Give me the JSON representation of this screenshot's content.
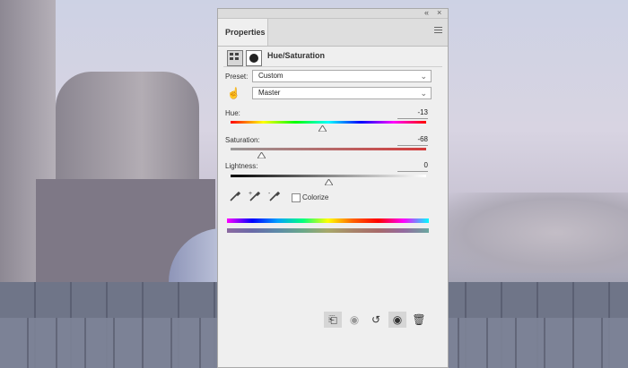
{
  "panel": {
    "tab_label": "Properties",
    "title": "Hue/Saturation",
    "window_controls": [
      "«",
      "×"
    ]
  },
  "preset": {
    "label": "Preset:",
    "value": "Custom"
  },
  "channel": {
    "value": "Master"
  },
  "hue": {
    "label": "Hue:",
    "value": "-13",
    "level": 0.47
  },
  "saturation": {
    "label": "Saturation:",
    "value": "-68",
    "level": 0.16
  },
  "lightness": {
    "label": "Lightness:",
    "value": "0",
    "level": 0.5
  },
  "colorize": {
    "label": "Colorize",
    "checked": false
  },
  "icons": {
    "layer_icon": "adjustment-layer-icon",
    "mask_icon": "mask-icon",
    "hand_icon": "targeted-adjustment-icon",
    "eyedroppers": [
      "eyedropper-icon",
      "eyedropper-add-icon",
      "eyedropper-subtract-icon"
    ],
    "footer": [
      "clip-to-layer-icon",
      "view-previous-state-icon",
      "reset-icon",
      "visibility-icon",
      "delete-icon"
    ]
  },
  "colors": {
    "accent": "#d33a3a",
    "panel_bg": "#efefef"
  }
}
